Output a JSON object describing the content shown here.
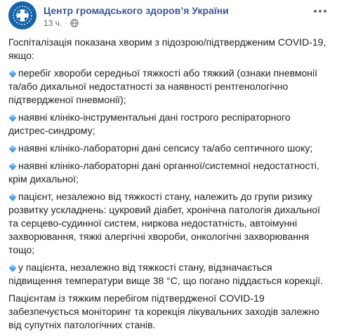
{
  "post": {
    "author": "Центр громадського здоров’я України",
    "time": "13 ч.",
    "separator": "·",
    "icons": {
      "avatar": "phc-logo-icon",
      "audience": "globe-icon",
      "menu": "more-options-icon",
      "bullet": "small-blue-diamond-icon"
    },
    "colors": {
      "author": "#385898",
      "avatar_bg": "#1565a8",
      "bullet": "#4aa3f0"
    },
    "intro": "Госпіталізація показана хворим з підозрою/підтвердженим COVID-19, якщо:",
    "items": [
      "перебіг хвороби середньої тяжкості або тяжкий (ознаки пневмонії та/або дихальної недостатності за наявності рентгенологічно підтвердженої пневмонії);",
      "наявні клініко-інструментальні дані гострого респіраторного дистрес-синдрому;",
      "наявні клініко-лабораторні дані сепсису та/або септичного шоку;",
      "наявні клініко-лабораторні дані органної/системної недостатності, крім дихальної;",
      "пацієнт, незалежно від тяжкості стану, належить до групи ризику розвитку ускладнень: цукровий діабет, хронічна патологія дихальної та серцево-судинної систем, ниркова недостатність, автоімунні захворювання, тяжкі алергічні хвороби, онкологічні захворювання тощо;",
      "у пацієнта, незалежно від тяжкості стану, відзначається підвищення температури вище 38 °C, що погано піддається корекції."
    ],
    "outro": "Пацієнтам із тяжким перебігом підтвердженої COVID-19 забезпечується моніторинг та корекція лікувальних заходів залежно від супутніх патологічних станів."
  }
}
